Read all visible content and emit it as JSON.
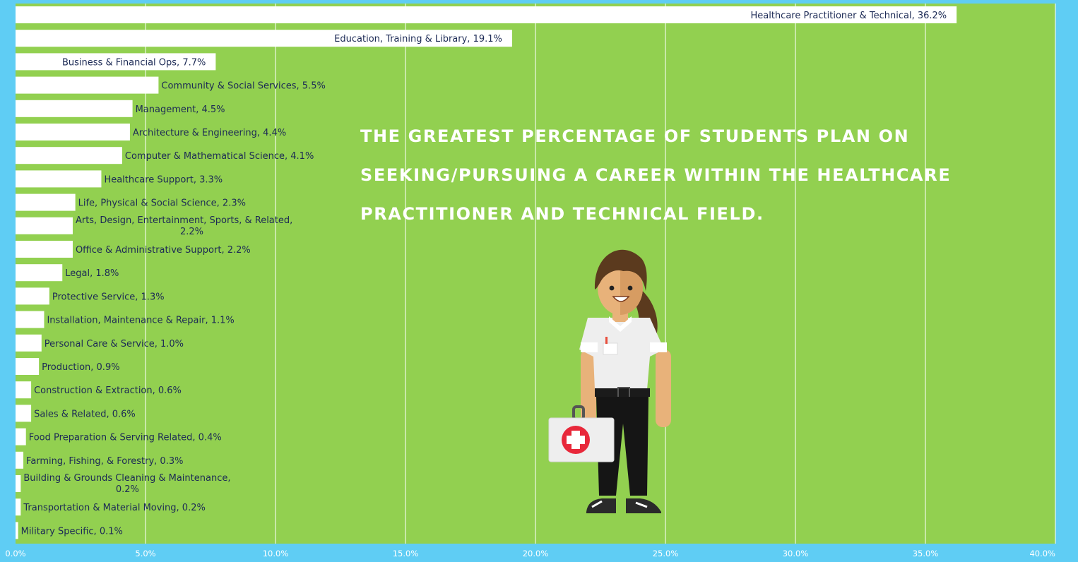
{
  "colors": {
    "background": "#5fcdf4",
    "plot_area": "#92d050",
    "bars": "#ffffff",
    "bar_label": "#1c2a55",
    "grid": "#ffffff"
  },
  "headline": "THE GREATEST PERCENTAGE OF STUDENTS PLAN ON SEEKING/PURSUING A CAREER WITHIN THE HEALTHCARE PRACTITIONER AND TECHNICAL FIELD.",
  "illustration": "nurse-with-first-aid-kit",
  "chart_data": {
    "type": "bar",
    "orientation": "horizontal",
    "xlim": [
      0,
      40
    ],
    "grid": true,
    "x_ticks": [
      "0.0%",
      "5.0%",
      "10.0%",
      "15.0%",
      "20.0%",
      "25.0%",
      "30.0%",
      "35.0%",
      "40.0%"
    ],
    "bars": [
      {
        "category": "Healthcare Practitioner & Technical",
        "value": 36.2,
        "label": [
          "Healthcare Practitioner & Technical, 36.2%"
        ]
      },
      {
        "category": "Education, Training & Library",
        "value": 19.1,
        "label": [
          "Education, Training & Library, 19.1%"
        ]
      },
      {
        "category": "Business & Financial Ops",
        "value": 7.7,
        "label": [
          "Business & Financial Ops, 7.7%"
        ]
      },
      {
        "category": "Community & Social Services",
        "value": 5.5,
        "label": [
          "Community & Social Services, 5.5%"
        ]
      },
      {
        "category": "Management",
        "value": 4.5,
        "label": [
          "Management, 4.5%"
        ]
      },
      {
        "category": "Architecture & Engineering",
        "value": 4.4,
        "label": [
          "Architecture & Engineering, 4.4%"
        ]
      },
      {
        "category": "Computer & Mathematical Science",
        "value": 4.1,
        "label": [
          "Computer & Mathematical Science, 4.1%"
        ]
      },
      {
        "category": "Healthcare Support",
        "value": 3.3,
        "label": [
          "Healthcare Support, 3.3%"
        ]
      },
      {
        "category": "Life, Physical & Social Science",
        "value": 2.3,
        "label": [
          "Life, Physical & Social Science, 2.3%"
        ]
      },
      {
        "category": "Arts, Design, Entertainment, Sports, & Related",
        "value": 2.2,
        "label": [
          "Arts, Design, Entertainment, Sports, & Related,",
          "2.2%"
        ]
      },
      {
        "category": "Office & Administrative Support",
        "value": 2.2,
        "label": [
          "Office & Administrative Support, 2.2%"
        ]
      },
      {
        "category": "Legal",
        "value": 1.8,
        "label": [
          "Legal, 1.8%"
        ]
      },
      {
        "category": "Protective Service",
        "value": 1.3,
        "label": [
          "Protective Service, 1.3%"
        ]
      },
      {
        "category": "Installation, Maintenance & Repair",
        "value": 1.1,
        "label": [
          "Installation, Maintenance & Repair, 1.1%"
        ]
      },
      {
        "category": "Personal Care & Service",
        "value": 1.0,
        "label": [
          "Personal Care & Service, 1.0%"
        ]
      },
      {
        "category": "Production",
        "value": 0.9,
        "label": [
          "Production, 0.9%"
        ]
      },
      {
        "category": "Construction & Extraction",
        "value": 0.6,
        "label": [
          "Construction & Extraction, 0.6%"
        ]
      },
      {
        "category": "Sales & Related",
        "value": 0.6,
        "label": [
          "Sales & Related, 0.6%"
        ]
      },
      {
        "category": "Food Preparation & Serving Related",
        "value": 0.4,
        "label": [
          "Food Preparation & Serving Related, 0.4%"
        ]
      },
      {
        "category": "Farming, Fishing, & Forestry",
        "value": 0.3,
        "label": [
          "Farming, Fishing, & Forestry, 0.3%"
        ]
      },
      {
        "category": "Building & Grounds Cleaning & Maintenance",
        "value": 0.2,
        "label": [
          "Building & Grounds Cleaning & Maintenance,",
          "0.2%"
        ]
      },
      {
        "category": "Transportation & Material Moving",
        "value": 0.2,
        "label": [
          "Transportation & Material Moving, 0.2%"
        ]
      },
      {
        "category": "Military Specific",
        "value": 0.1,
        "label": [
          "Military Specific, 0.1%"
        ]
      }
    ]
  }
}
